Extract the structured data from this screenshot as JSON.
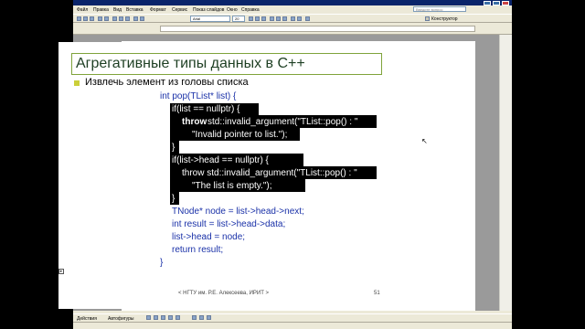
{
  "app": {
    "menu": [
      "Файл",
      "Правка",
      "Вид",
      "Вставка",
      "Формат",
      "Сервис",
      "Показ слайдов",
      "Окно",
      "Справка"
    ],
    "help_placeholder": "Введите вопрос",
    "font_name": "Arial",
    "font_size": "20",
    "design_label": "Конструктор",
    "drawing": {
      "actions_label": "Действия",
      "autoshapes_label": "Автофигуры"
    }
  },
  "slide": {
    "title": "Агрегативные типы данных в С++",
    "subtitle": "Извлечь элемент из головы списка",
    "code_lines": [
      "int pop(TList* list) {",
      "if(list == nullptr) {",
      "throw",
      " std::invalid_argument(\"TList::pop() : \"",
      "\"Invalid pointer to list.\");",
      "}",
      "if(list->head == nullptr) {",
      "throw std::invalid_argument(\"TList::pop() : \"",
      "\"The list is empty.\");",
      "}",
      "TNode* node = list->head->next;",
      "int result = list->head->data;",
      "list->head = node;",
      "return result;",
      "}"
    ],
    "footer": "< НГТУ им. Р.Е. Алексеева, ИРИТ >",
    "page_number": "51"
  },
  "colors": {
    "code_blue": "#1a31a8",
    "title_border": "#7fa33b",
    "bullet": "#cbcf3a",
    "highlight": "#000000"
  }
}
